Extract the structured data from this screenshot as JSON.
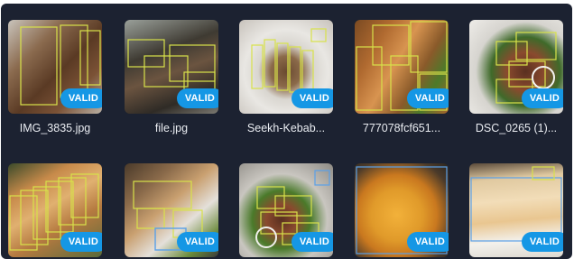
{
  "gallery": {
    "items": [
      {
        "filename": "IMG_3835.jpg",
        "status": "VALID"
      },
      {
        "filename": "file.jpg",
        "status": "VALID"
      },
      {
        "filename": "Seekh-Kebab...",
        "status": "VALID"
      },
      {
        "filename": "777078fcf651...",
        "status": "VALID"
      },
      {
        "filename": "DSC_0265 (1)...",
        "status": "VALID"
      },
      {
        "filename": "",
        "status": "VALID"
      },
      {
        "filename": "",
        "status": "VALID"
      },
      {
        "filename": "",
        "status": "VALID"
      },
      {
        "filename": "",
        "status": "VALID"
      },
      {
        "filename": "",
        "status": "VALID"
      }
    ],
    "colors": {
      "background": "#1c2231",
      "badge": "#1597e5",
      "bounding_box": "#d8e24a",
      "bounding_box_alt": "#5aa0e8"
    }
  }
}
